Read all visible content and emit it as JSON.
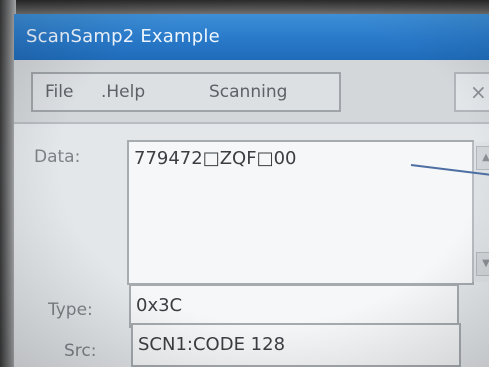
{
  "window": {
    "title": "ScanSamp2 Example",
    "close_glyph": "×"
  },
  "menu": {
    "items": [
      "File",
      ".Help",
      "Scanning"
    ]
  },
  "fields": {
    "data": {
      "label": "Data:",
      "value": "779472□ZQF□00"
    },
    "type": {
      "label": "Type:",
      "value": "0x3C"
    },
    "src": {
      "label": "Src:",
      "value": "SCN1:CODE 128"
    }
  },
  "scroll": {
    "up_icon": "▲",
    "down_icon": "▼"
  },
  "colors": {
    "titlebar": "#2b7bcb",
    "accent_line": "#4e6fa3"
  }
}
